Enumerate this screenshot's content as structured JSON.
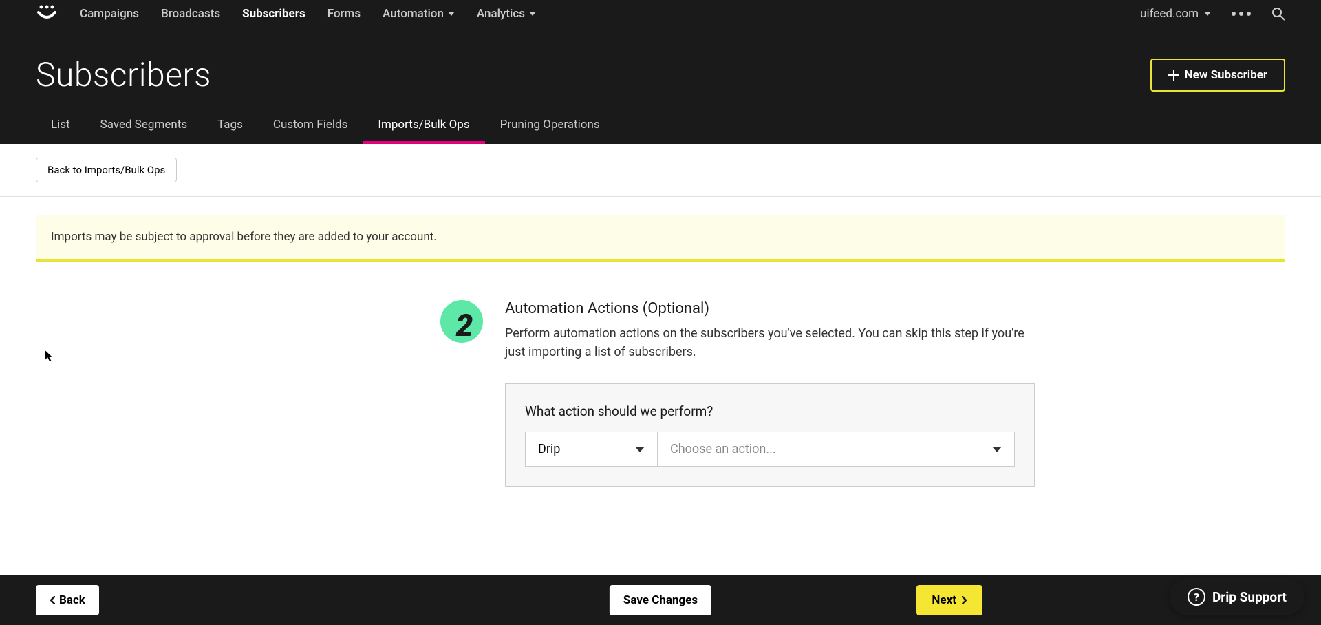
{
  "nav": {
    "items": [
      {
        "label": "Campaigns"
      },
      {
        "label": "Broadcasts"
      },
      {
        "label": "Subscribers"
      },
      {
        "label": "Forms"
      },
      {
        "label": "Automation"
      },
      {
        "label": "Analytics"
      }
    ],
    "account": "uifeed.com"
  },
  "page": {
    "title": "Subscribers",
    "new_button": "New Subscriber"
  },
  "subtabs": [
    {
      "label": "List"
    },
    {
      "label": "Saved Segments"
    },
    {
      "label": "Tags"
    },
    {
      "label": "Custom Fields"
    },
    {
      "label": "Imports/Bulk Ops"
    },
    {
      "label": "Pruning Operations"
    }
  ],
  "back_link": "Back to Imports/Bulk Ops",
  "banner": "Imports may be subject to approval before they are added to your account.",
  "step": {
    "number": "2",
    "title": "Automation Actions (Optional)",
    "description": "Perform automation actions on the subscribers you've selected. You can skip this step if you're just importing a list of subscribers.",
    "action_label": "What action should we perform?",
    "select1": "Drip",
    "select2_placeholder": "Choose an action..."
  },
  "footer": {
    "back": "Back",
    "save": "Save Changes",
    "next": "Next"
  },
  "support": "Drip Support"
}
